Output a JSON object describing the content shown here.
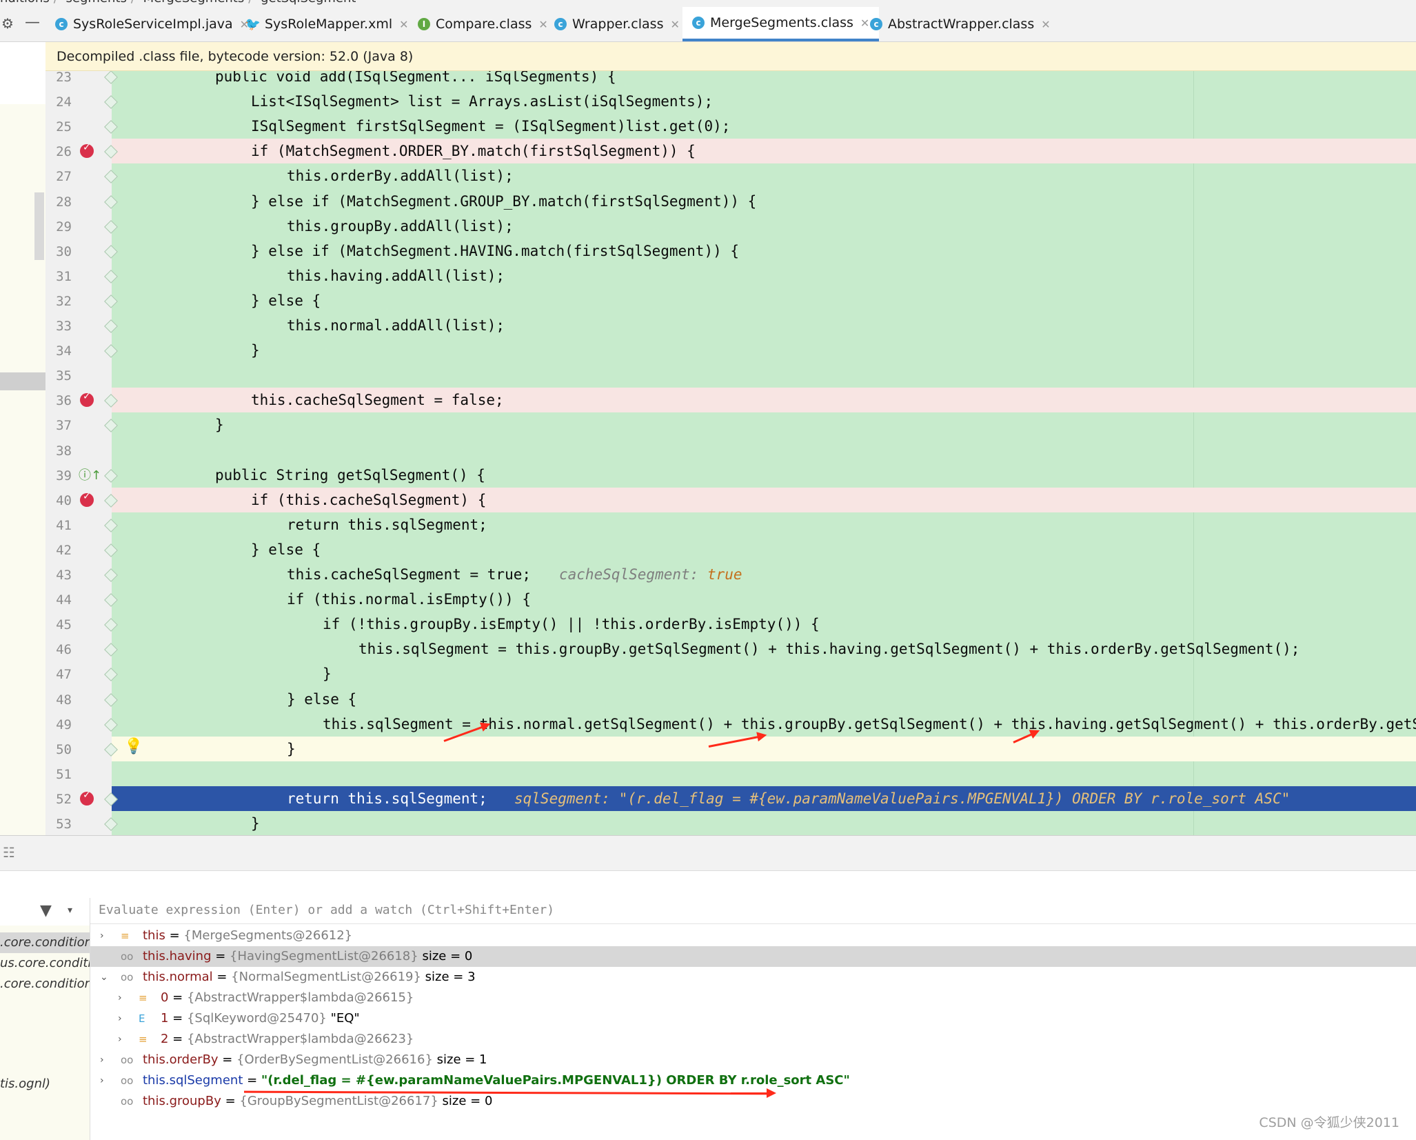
{
  "breadcrumbs": [
    "nditions",
    "segments",
    "MergeSegments",
    "getSqlSegment"
  ],
  "tabs": [
    {
      "label": "SysRoleServiceImpl.java",
      "icon": "class-icon"
    },
    {
      "label": "SysRoleMapper.xml",
      "icon": "mybatis-icon"
    },
    {
      "label": "Compare.class",
      "icon": "interface-icon"
    },
    {
      "label": "Wrapper.class",
      "icon": "abstract-class-icon"
    },
    {
      "label": "MergeSegments.class",
      "icon": "class-icon",
      "active": true
    },
    {
      "label": "AbstractWrapper.class",
      "icon": "abstract-class-icon"
    }
  ],
  "banner": "Decompiled .class file, bytecode version: 52.0 (Java 8)",
  "line_numbers": [
    "23",
    "24",
    "25",
    "26",
    "27",
    "28",
    "29",
    "30",
    "31",
    "32",
    "33",
    "34",
    "35",
    "36",
    "37",
    "38",
    "39",
    "40",
    "41",
    "42",
    "43",
    "44",
    "45",
    "46",
    "47",
    "48",
    "49",
    "50",
    "51",
    "52",
    "53"
  ],
  "code": {
    "l23": "public void add(ISqlSegment... iSqlSegments) {",
    "l24": "List<ISqlSegment> list = Arrays.asList(iSqlSegments);",
    "l25": "ISqlSegment firstSqlSegment = (ISqlSegment)list.get(0);",
    "l26": "if (MatchSegment.ORDER_BY.match(firstSqlSegment)) {",
    "l27": "this.orderBy.addAll(list);",
    "l28": "} else if (MatchSegment.GROUP_BY.match(firstSqlSegment)) {",
    "l29": "this.groupBy.addAll(list);",
    "l30": "} else if (MatchSegment.HAVING.match(firstSqlSegment)) {",
    "l31": "this.having.addAll(list);",
    "l32": "} else {",
    "l33": "this.normal.addAll(list);",
    "l34": "}",
    "l36": "this.cacheSqlSegment = false;",
    "l37": "}",
    "l39": "public String getSqlSegment() {",
    "l40": "if (this.cacheSqlSegment) {",
    "l41": "return this.sqlSegment;",
    "l42": "} else {",
    "l43": "this.cacheSqlSegment = true;",
    "l43_hint_name": "cacheSqlSegment:",
    "l43_hint_value": "true",
    "l44": "if (this.normal.isEmpty()) {",
    "l45": "if (!this.groupBy.isEmpty() || !this.orderBy.isEmpty()) {",
    "l46": "this.sqlSegment = this.groupBy.getSqlSegment() + this.having.getSqlSegment() + this.orderBy.getSqlSegment();",
    "l47": "}",
    "l48": "} else {",
    "l49": "this.sqlSegment = this.normal.getSqlSegment() + this.groupBy.getSqlSegment() + this.having.getSqlSegment() + this.orderBy.getSqlS",
    "l50": "}",
    "l52": "return this.sqlSegment;",
    "l52_hint": "sqlSegment: \"(r.del_flag = #{ew.paramNameValuePairs.MPGENVAL1}) ORDER BY r.role_sort ASC\"",
    "l53": "}"
  },
  "debug": {
    "eval_placeholder": "Evaluate expression (Enter) or add a watch (Ctrl+Shift+Enter)",
    "frames": [
      ".core.conditions",
      "us.core.conditio",
      ".core.conditions",
      "tis.ognl)"
    ],
    "variables": [
      {
        "name": "this",
        "eq": " = ",
        "type": "{MergeSegments@26612}",
        "extra": ""
      },
      {
        "name": "this.having",
        "eq": " = ",
        "type": "{HavingSegmentList@26618}",
        "extra": "  size = 0"
      },
      {
        "name": "this.normal",
        "eq": " = ",
        "type": "{NormalSegmentList@26619}",
        "extra": "  size = 3"
      },
      {
        "name": "0",
        "eq": " = ",
        "type": "{AbstractWrapper$lambda@26615}",
        "extra": ""
      },
      {
        "name": "1",
        "eq": " = ",
        "type": "{SqlKeyword@25470}",
        "extra": " \"EQ\""
      },
      {
        "name": "2",
        "eq": " = ",
        "type": "{AbstractWrapper$lambda@26623}",
        "extra": ""
      },
      {
        "name": "this.orderBy",
        "eq": " = ",
        "type": "{OrderBySegmentList@26616}",
        "extra": "  size = 1"
      },
      {
        "name": "this.sqlSegment",
        "eq": " = ",
        "type": "",
        "extra": "\"(r.del_flag = #{ew.paramNameValuePairs.MPGENVAL1}) ORDER BY r.role_sort ASC\""
      },
      {
        "name": "this.groupBy",
        "eq": " = ",
        "type": "{GroupBySegmentList@26617}",
        "extra": "  size = 0"
      }
    ]
  },
  "watermark": "CSDN @令狐少侠2011",
  "colors": {
    "accent": "#4083c9",
    "breakpoint": "#d9304a",
    "exec_line": "#2c55a7",
    "diff_green": "#c7ebcc",
    "annotation_red": "#ff2a1a"
  }
}
